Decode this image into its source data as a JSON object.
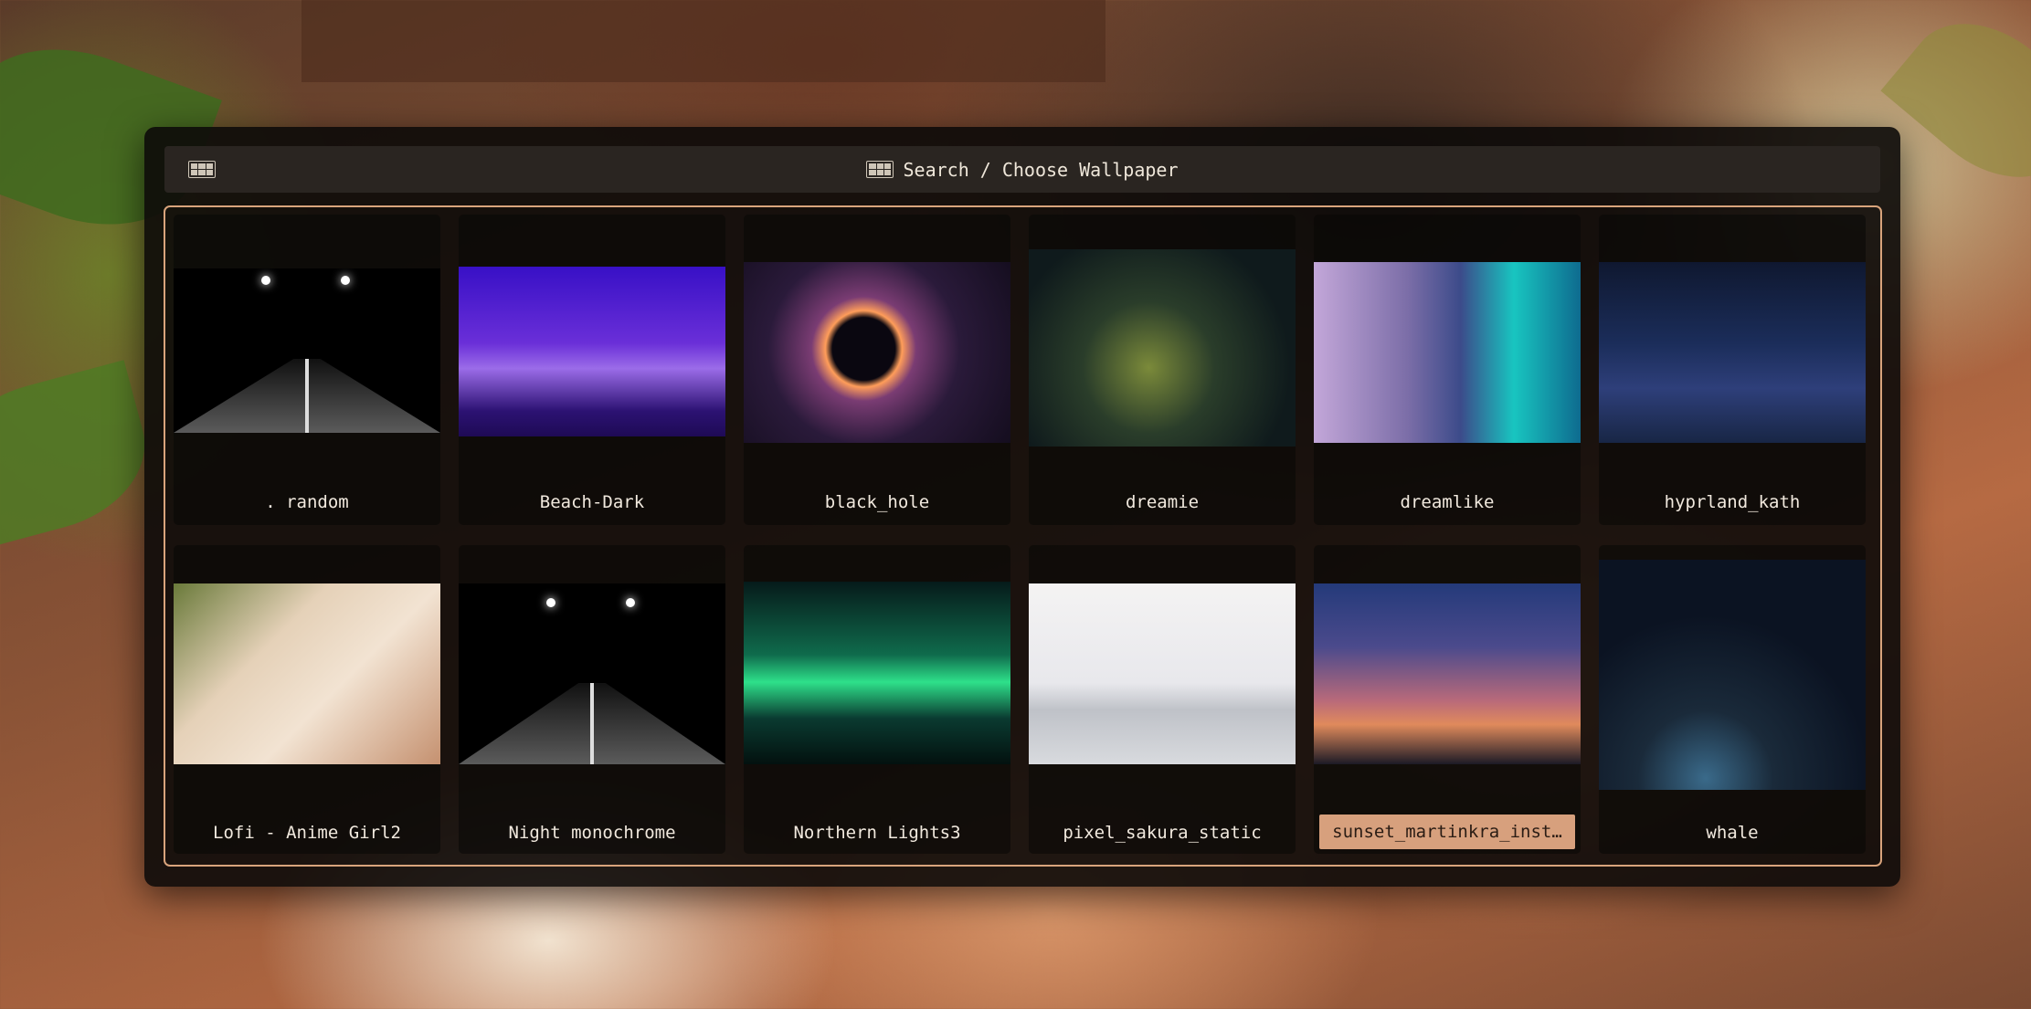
{
  "window": {
    "title": "Search / Choose Wallpaper",
    "title_icon": "gif-icon",
    "left_icon": "gif-icon"
  },
  "wallpapers": [
    {
      "label": ". random",
      "thumb": "road-at-night"
    },
    {
      "label": "Beach-Dark",
      "thumb": "purple-coast"
    },
    {
      "label": "black_hole",
      "thumb": "black-hole"
    },
    {
      "label": "dreamie",
      "thumb": "enchanted-forest"
    },
    {
      "label": "dreamlike",
      "thumb": "aurora-sky-planet"
    },
    {
      "label": "hyprland_kath",
      "thumb": "neon-room-girl"
    },
    {
      "label": "Lofi - Anime Girl2",
      "thumb": "lofi-girl"
    },
    {
      "label": "Night monochrome",
      "thumb": "road-at-night"
    },
    {
      "label": "Northern Lights3",
      "thumb": "northern-lights"
    },
    {
      "label": "pixel_sakura_static",
      "thumb": "pixel-sakura"
    },
    {
      "label": "sunset_martinkra_inst…",
      "thumb": "sunset",
      "selected": true
    },
    {
      "label": "whale",
      "thumb": "flying-whale"
    }
  ],
  "colors": {
    "accent_border": "#d9a47c",
    "selected_bg": "#d7a07d",
    "window_bg": "#0c0a09",
    "titlebar_bg": "#2a2521",
    "text": "#f1e9de"
  }
}
